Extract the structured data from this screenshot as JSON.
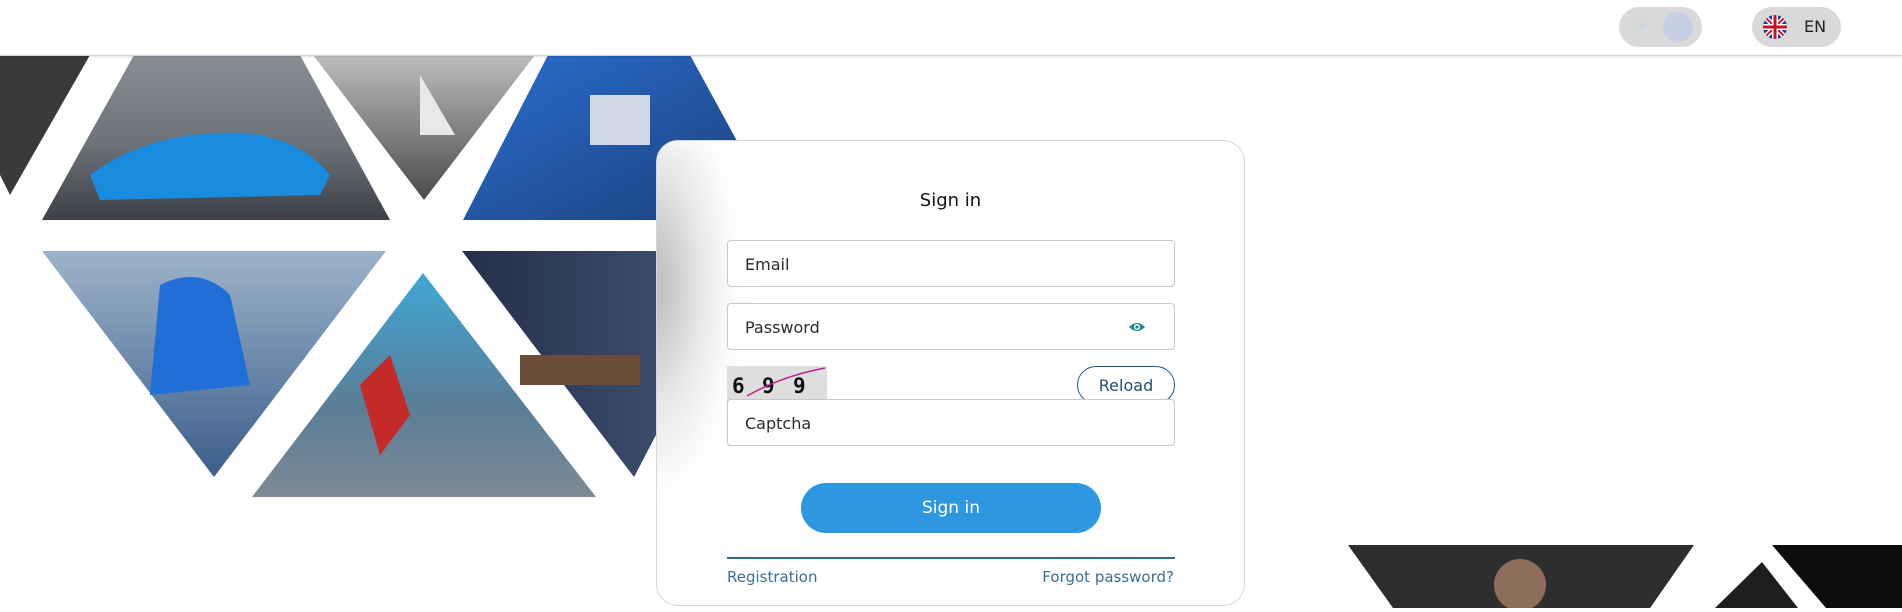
{
  "header": {
    "theme_toggle": {
      "sun_icon": "sun-icon",
      "moon_icon": "moon-icon",
      "state": "dark"
    },
    "language": {
      "flag_icon": "uk-flag-icon",
      "code": "EN"
    }
  },
  "login": {
    "title": "Sign in",
    "email_placeholder": "Email",
    "password_placeholder": "Password",
    "show_password_icon": "eye-icon",
    "captcha_digits": [
      "6",
      "9",
      "9"
    ],
    "reload_label": "Reload",
    "captcha_placeholder": "Captcha",
    "submit_label": "Sign in",
    "registration_link": "Registration",
    "forgot_link": "Forgot password?"
  },
  "colors": {
    "accent": "#2f97e0",
    "link": "#3a6f97",
    "eye": "#1f8a8a"
  }
}
